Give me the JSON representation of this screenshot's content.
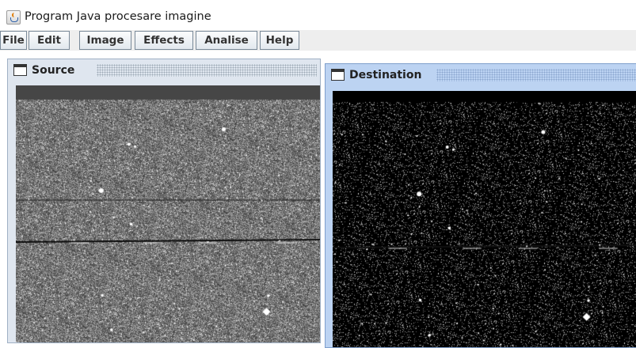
{
  "window": {
    "title": "Program Java procesare imagine",
    "app_icon": "java-cup-icon"
  },
  "menubar": {
    "items": [
      {
        "label": "File"
      },
      {
        "label": "Edit"
      },
      {
        "label": "Image"
      },
      {
        "label": "Effects"
      },
      {
        "label": "Analise"
      },
      {
        "label": "Help"
      }
    ]
  },
  "frames": {
    "source": {
      "title": "Source",
      "icon": "internal-frame-icon",
      "image": "noisy grayscale star field"
    },
    "destination": {
      "title": "Destination",
      "icon": "internal-frame-icon",
      "image": "thresholded dark star field"
    }
  },
  "colors": {
    "menu_border": "#7a8a99",
    "source_frame": "#dfe6ef",
    "destination_frame_active": "#bcd3f2"
  }
}
